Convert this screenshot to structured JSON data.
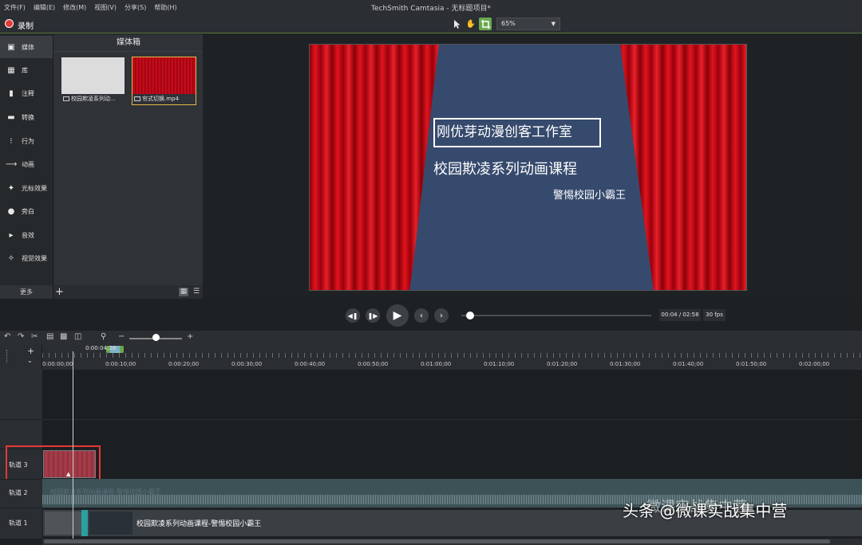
{
  "menu": [
    "文件(F)",
    "编辑(E)",
    "修改(M)",
    "视图(V)",
    "分享(S)",
    "帮助(H)"
  ],
  "window_title": "TechSmith Camtasia - 无标题项目*",
  "toolbar": {
    "record_label": "录制",
    "zoom_value": "65%"
  },
  "sidenav": {
    "items": [
      {
        "label": "媒体",
        "icon": "film-icon"
      },
      {
        "label": "库",
        "icon": "library-icon"
      },
      {
        "label": "注释",
        "icon": "annotation-icon"
      },
      {
        "label": "转换",
        "icon": "transition-icon"
      },
      {
        "label": "行为",
        "icon": "behavior-icon"
      },
      {
        "label": "动画",
        "icon": "animation-icon"
      },
      {
        "label": "光标效果",
        "icon": "cursor-icon"
      },
      {
        "label": "旁白",
        "icon": "microphone-icon"
      },
      {
        "label": "音效",
        "icon": "speaker-icon"
      },
      {
        "label": "视觉效果",
        "icon": "magic-wand-icon"
      }
    ],
    "more_label": "更多"
  },
  "media_bin": {
    "title": "媒体箱",
    "items": [
      {
        "name": "校园欺凌系列动..."
      },
      {
        "name": "帘式切换.mp4"
      }
    ]
  },
  "preview": {
    "line1": "刚优芽动漫创客工作室",
    "line2": "校园欺凌系列动画课程",
    "line3": "警惕校园小霸王"
  },
  "playback": {
    "time": "00:04 / 02:58",
    "fps": "30 fps",
    "progress": 0.02
  },
  "timeline": {
    "playhead_time": "0:00:04;28",
    "ticks": [
      "0:00:00;00",
      "0:00:10;00",
      "0:00:20;00",
      "0:00:30;00",
      "0:00:40;00",
      "0:00:50;00",
      "0:01:00;00",
      "0:01:10;00",
      "0:01:20;00",
      "0:01:30;00",
      "0:01:40;00",
      "0:01:50;00",
      "0:02:00;00"
    ],
    "tracks": [
      {
        "name": "轨道 3"
      },
      {
        "name": "轨道 2",
        "clip_label": "校园欺凌系列动画课程-警惕校园小霸王"
      },
      {
        "name": "轨道 1",
        "clip_label": "校园欺凌系列动画课程-警惕校园小霸王"
      }
    ]
  },
  "watermark": {
    "top": "微课实战集中营",
    "bottom": "头条 @微课实战集中营"
  }
}
